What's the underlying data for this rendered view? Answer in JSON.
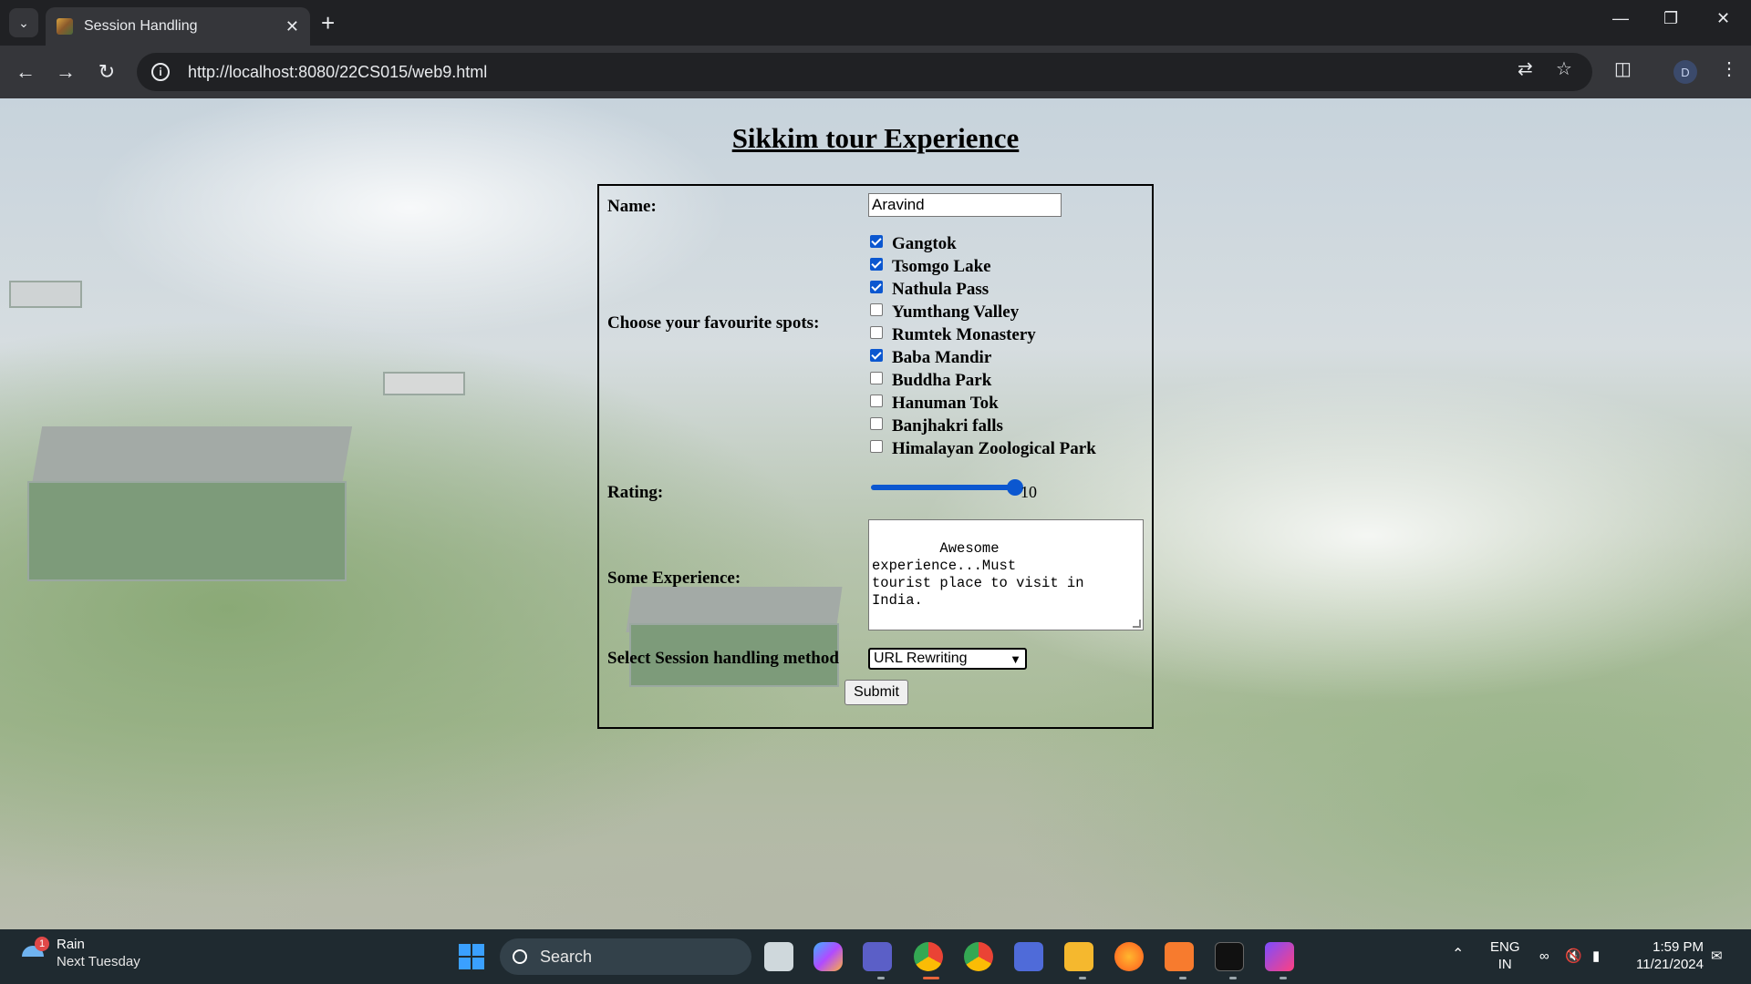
{
  "browser": {
    "tab_title": "Session Handling",
    "url_host": "http://localhost",
    "url_path": ":8080/22CS015/web9.html",
    "profile_initial": "D"
  },
  "page": {
    "heading": "Sikkim tour Experience",
    "name_label": "Name:",
    "name_value": "Aravind",
    "spots_label": "Choose your favourite spots:",
    "spots": [
      {
        "label": "Gangtok",
        "checked": true
      },
      {
        "label": "Tsomgo Lake",
        "checked": true
      },
      {
        "label": "Nathula Pass",
        "checked": true
      },
      {
        "label": "Yumthang Valley",
        "checked": false
      },
      {
        "label": "Rumtek Monastery",
        "checked": false
      },
      {
        "label": "Baba Mandir",
        "checked": true
      },
      {
        "label": "Buddha Park",
        "checked": false
      },
      {
        "label": "Hanuman Tok",
        "checked": false
      },
      {
        "label": "Banjhakri falls",
        "checked": false
      },
      {
        "label": "Himalayan Zoological Park",
        "checked": false
      }
    ],
    "rating_label": "Rating:",
    "rating_value": "10",
    "rating_max": 10,
    "experience_label": "Some Experience:",
    "experience_text": "Awesome experience...Must\ntourist place to visit in India.",
    "session_label": "Select Session handling method",
    "session_selected": "URL Rewriting",
    "submit_label": "Submit"
  },
  "taskbar": {
    "weather_title": "Rain",
    "weather_sub": "Next Tuesday",
    "weather_badge": "1",
    "search_placeholder": "Search",
    "lang_top": "ENG",
    "lang_bottom": "IN",
    "time": "1:59 PM",
    "date": "11/21/2024"
  },
  "colors": {
    "accent": "#0b57d0",
    "chrome_dark": "#202124",
    "chrome_toolbar": "#35363a",
    "taskbar": "#1f2a30"
  }
}
